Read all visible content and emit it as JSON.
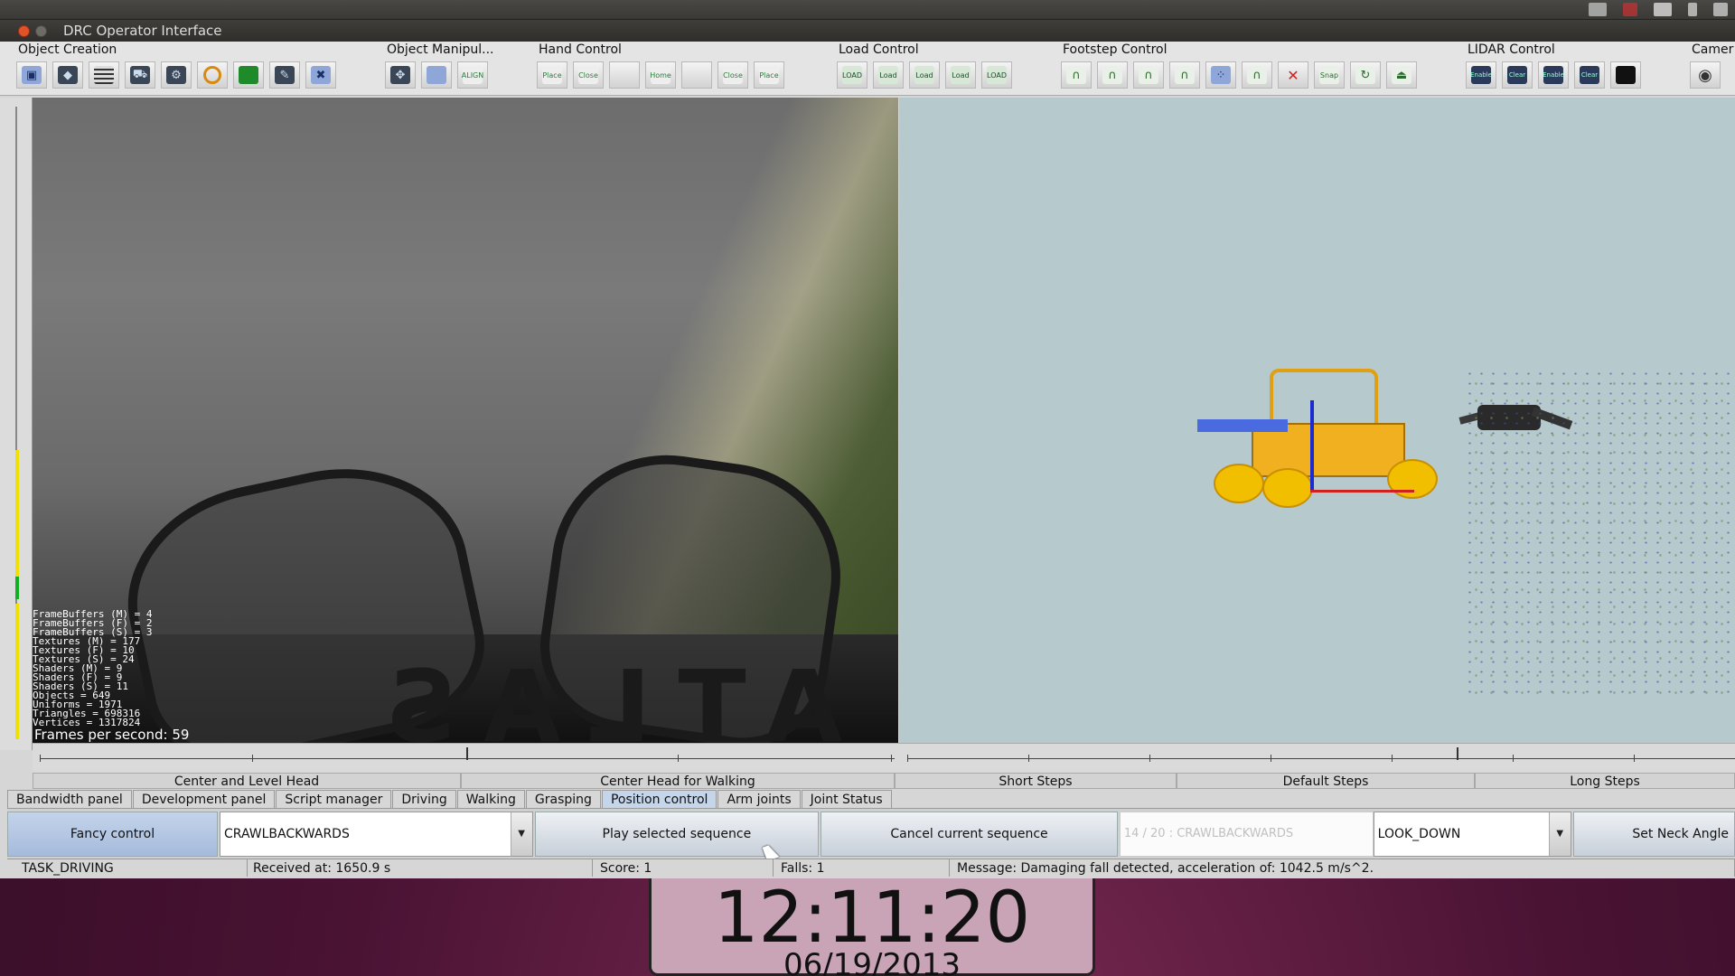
{
  "window": {
    "title": "DRC Operator Interface"
  },
  "toolbar": {
    "groups": [
      {
        "title": "Object Creation"
      },
      {
        "title": "Object Manipul..."
      },
      {
        "title": "Hand Control"
      },
      {
        "title": "Load Control"
      },
      {
        "title": "Footstep Control"
      },
      {
        "title": "LIDAR Control"
      },
      {
        "title": "Camer"
      }
    ],
    "labels": {
      "align": "ALIGN",
      "place": "Place",
      "close": "Close",
      "home": "Home",
      "load": "LOAD",
      "load_lc": "Load",
      "snap": "Snap",
      "enable": "Enable",
      "clear": "Clear"
    }
  },
  "camera": {
    "stats": [
      "FrameBuffers (M) = 4",
      "FrameBuffers (F) = 2",
      "FrameBuffers (S) = 3",
      "Textures (M) = 177",
      "Textures (F) = 10",
      "Textures (S) = 24",
      "Shaders (M) = 9",
      "Shaders (F) = 9",
      "Shaders (S) = 11",
      "Objects = 649",
      "Uniforms = 1971",
      "Triangles = 698316",
      "Vertices = 1317824"
    ],
    "fps": "Frames per second: 59",
    "body_text": "ATLAS"
  },
  "presets": [
    "Center and Level Head",
    "Center Head for Walking",
    "Short Steps",
    "Default Steps",
    "Long Steps"
  ],
  "tabs": [
    "Bandwidth panel",
    "Development panel",
    "Script manager",
    "Driving",
    "Walking",
    "Grasping",
    "Position control",
    "Arm joints",
    "Joint Status"
  ],
  "active_tab": "Position control",
  "controls": {
    "fancy": "Fancy control",
    "sequence": "CRAWLBACKWARDS",
    "play": "Play selected sequence",
    "cancel": "Cancel current sequence",
    "progress": "14 / 20 : CRAWLBACKWARDS",
    "look": "LOOK_DOWN",
    "neck": "Set Neck Angle"
  },
  "status": {
    "task": "TASK_DRIVING",
    "received": "Received at:  1650.9 s",
    "score": "Score:  1",
    "falls": "Falls:  1",
    "message": "Message:  Damaging fall detected, acceleration of: 1042.5 m/s^2."
  },
  "clock": {
    "time": "12:11:20",
    "date": "06/19/2013"
  },
  "colors": {
    "accent": "#c5d5ea",
    "vehicle": "#f0b020",
    "view_bg": "#b6cacd"
  }
}
